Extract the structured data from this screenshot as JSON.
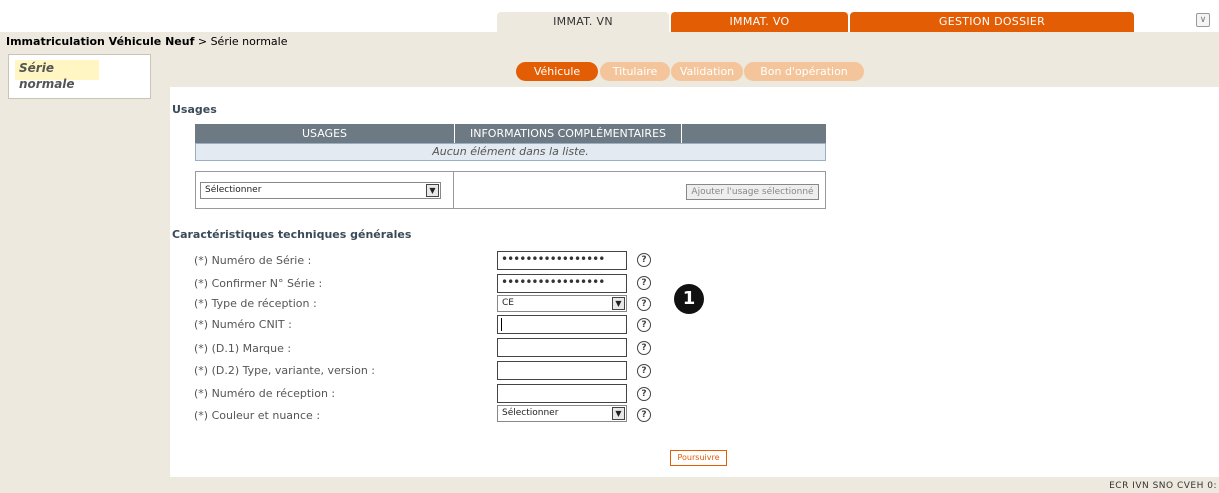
{
  "top_tabs": {
    "immat_vn": "IMMAT. VN",
    "immat_vo": "IMMAT. VO",
    "gestion_dossier": "GESTION DOSSIER"
  },
  "collapse_icon": "collapse-icon",
  "breadcrumb": {
    "bold": "Immatriculation Véhicule Neuf",
    "sep": " > ",
    "current": "Série normale"
  },
  "sidebar": {
    "active_item": "Série normale"
  },
  "steps": {
    "vehicule": "Véhicule",
    "titulaire": "Titulaire",
    "validation": "Validation",
    "bon": "Bon d'opération"
  },
  "usages": {
    "title": "Usages",
    "col_usages": "USAGES",
    "col_info": "INFORMATIONS COMPLÉMENTAIRES",
    "empty": "Aucun élément dans la liste.",
    "select_value": "Sélectionner",
    "add_button": "Ajouter l'usage sélectionné"
  },
  "caracteristiques": {
    "title": "Caractéristiques techniques générales",
    "fields": {
      "numero_serie": {
        "label": "(*) Numéro de Série :",
        "value": "•••••••••••••••••"
      },
      "confirmer_serie": {
        "label": "(*) Confirmer N° Série :",
        "value": "•••••••••••••••••"
      },
      "type_reception": {
        "label": "(*) Type de réception :",
        "value": "CE"
      },
      "numero_cnit": {
        "label": "(*) Numéro CNIT :",
        "value": ""
      },
      "marque": {
        "label": "(*) (D.1) Marque :",
        "value": ""
      },
      "type_variante": {
        "label": "(*) (D.2) Type, variante, version :",
        "value": ""
      },
      "numero_reception": {
        "label": "(*) Numéro de réception  :",
        "value": ""
      },
      "couleur": {
        "label": "(*) Couleur et nuance :",
        "value": "Sélectionner"
      }
    },
    "help_glyph": "?"
  },
  "callout_number": "1",
  "poursuivre": "Poursuivre",
  "footer_code": "ECR IVN SNO CVEH 0:"
}
